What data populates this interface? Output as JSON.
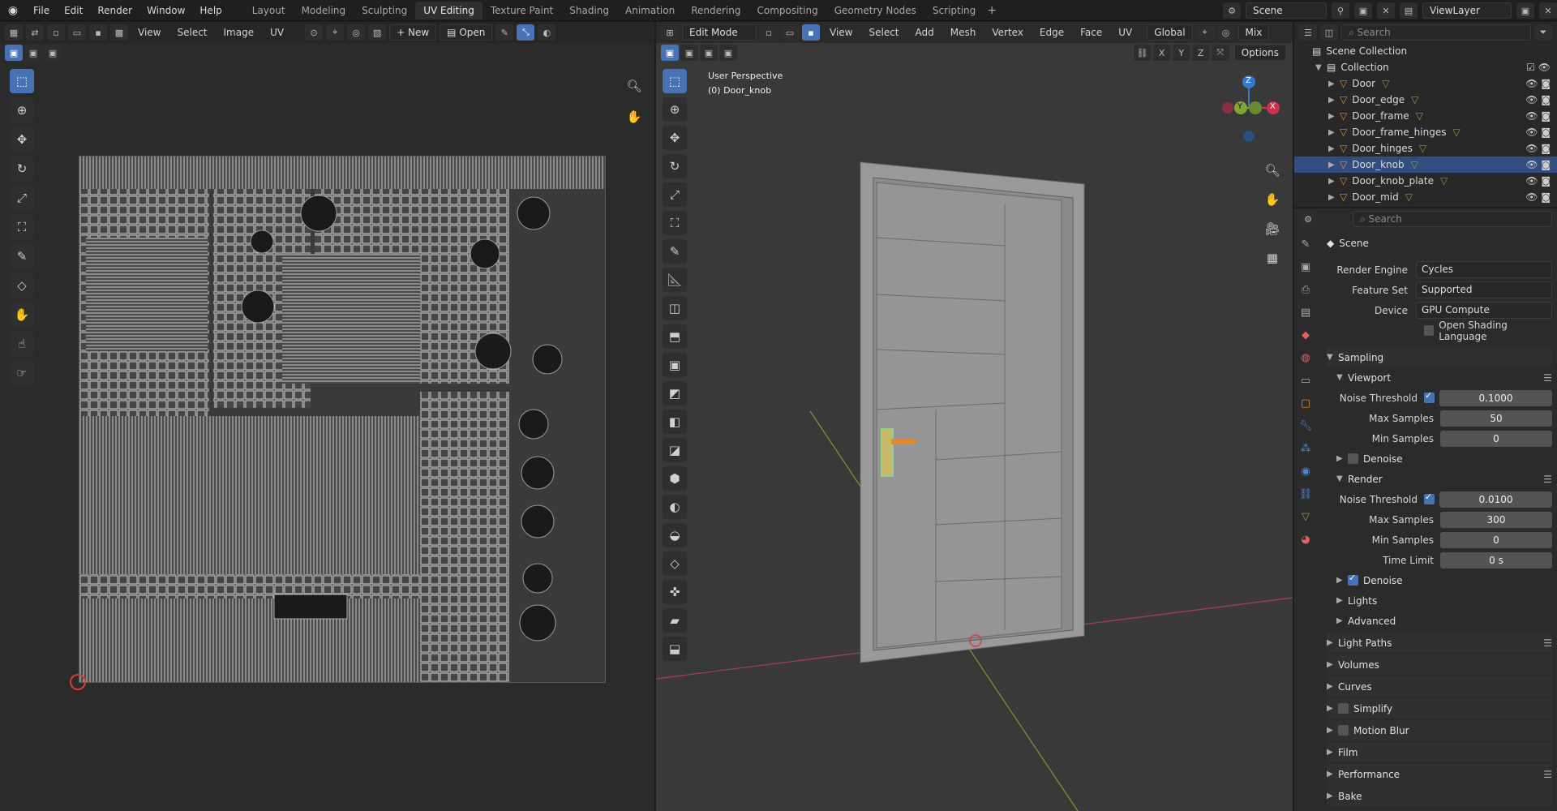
{
  "topbar": {
    "menus": [
      "File",
      "Edit",
      "Render",
      "Window",
      "Help"
    ],
    "workspaces": [
      "Layout",
      "Modeling",
      "Sculpting",
      "UV Editing",
      "Texture Paint",
      "Shading",
      "Animation",
      "Rendering",
      "Compositing",
      "Geometry Nodes",
      "Scripting"
    ],
    "active_workspace": "UV Editing",
    "scene": "Scene",
    "view_layer": "ViewLayer"
  },
  "uv_editor": {
    "menus": [
      "View",
      "Select",
      "Image",
      "UV"
    ],
    "new_label": "New",
    "open_label": "Open"
  },
  "viewport": {
    "mode": "Edit Mode",
    "menus": [
      "View",
      "Select",
      "Add",
      "Mesh",
      "Vertex",
      "Edge",
      "Face",
      "UV"
    ],
    "orientation": "Global",
    "proportional": "Mix",
    "options_label": "Options",
    "axes": [
      "X",
      "Y",
      "Z"
    ],
    "overlay_line1": "User Perspective",
    "overlay_line2": "(0) Door_knob",
    "gizmo": {
      "x": "X",
      "y": "Y",
      "z": "Z"
    }
  },
  "outliner": {
    "search_placeholder": "Search",
    "root": "Scene Collection",
    "collection": "Collection",
    "items": [
      "Door",
      "Door_edge",
      "Door_frame",
      "Door_frame_hinges",
      "Door_hinges",
      "Door_knob",
      "Door_knob_plate",
      "Door_mid"
    ],
    "selected": "Door_knob"
  },
  "properties": {
    "search_placeholder": "Search",
    "context": "Scene",
    "render_engine_label": "Render Engine",
    "render_engine": "Cycles",
    "feature_set_label": "Feature Set",
    "feature_set": "Supported",
    "device_label": "Device",
    "device": "GPU Compute",
    "osl_label": "Open Shading Language",
    "sampling": "Sampling",
    "viewport_label": "Viewport",
    "noise_threshold_label": "Noise Threshold",
    "viewport_noise": "0.1000",
    "max_samples_label": "Max Samples",
    "viewport_max": "50",
    "min_samples_label": "Min Samples",
    "viewport_min": "0",
    "denoise_label": "Denoise",
    "render_label": "Render",
    "render_noise": "0.0100",
    "render_max": "300",
    "render_min": "0",
    "time_limit_label": "Time Limit",
    "time_limit": "0 s",
    "lights": "Lights",
    "advanced": "Advanced",
    "light_paths": "Light Paths",
    "volumes": "Volumes",
    "curves": "Curves",
    "simplify": "Simplify",
    "motion_blur": "Motion Blur",
    "film": "Film",
    "performance": "Performance",
    "bake": "Bake"
  },
  "colors": {
    "accent": "#4772b3",
    "selected_row": "#334d80",
    "x_axis": "#c7344b",
    "y_axis": "#7fa63b",
    "z_axis": "#3a78c8",
    "active_object": "#e6872b"
  }
}
